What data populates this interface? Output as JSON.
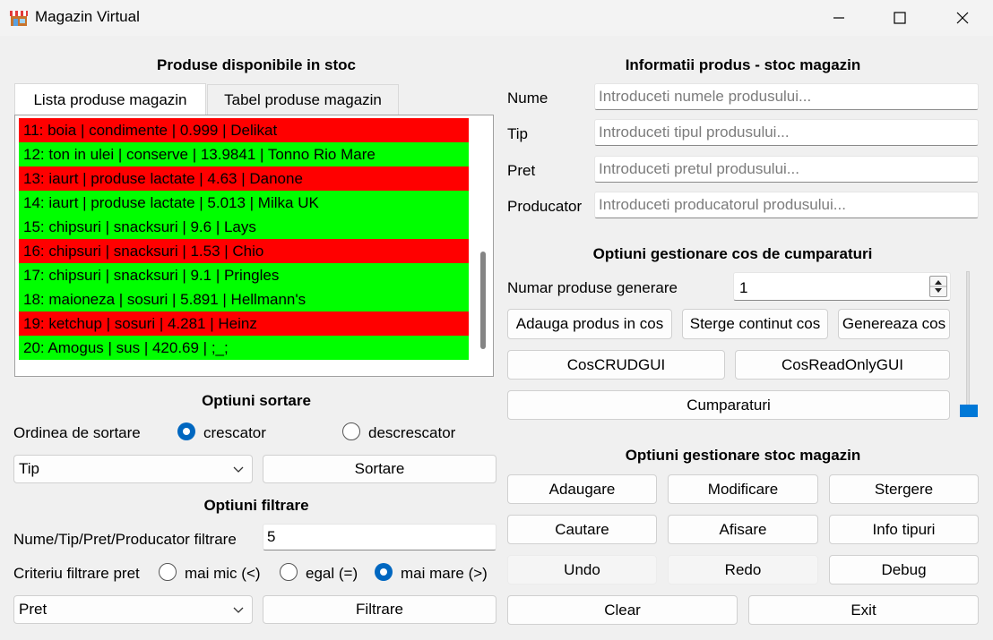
{
  "window": {
    "title": "Magazin Virtual",
    "minimize_glyph": "—",
    "maximize_glyph": "☐",
    "close_glyph": "✕"
  },
  "left": {
    "list_heading": "Produse disponibile in stoc",
    "tabs": [
      {
        "label": "Lista produse magazin",
        "active": true
      },
      {
        "label": "Tabel produse magazin",
        "active": false
      }
    ],
    "products": [
      {
        "text": "11: boia | condimente | 0.999 | Delikat",
        "color": "#ff0000"
      },
      {
        "text": "12: ton in ulei | conserve | 13.9841 | Tonno Rio Mare",
        "color": "#00ff00"
      },
      {
        "text": "13: iaurt | produse lactate | 4.63 | Danone",
        "color": "#ff0000"
      },
      {
        "text": "14: iaurt | produse lactate | 5.013 | Milka UK",
        "color": "#00ff00"
      },
      {
        "text": "15: chipsuri | snacksuri | 9.6 | Lays",
        "color": "#00ff00"
      },
      {
        "text": "16: chipsuri | snacksuri | 1.53 | Chio",
        "color": "#ff0000"
      },
      {
        "text": "17: chipsuri | snacksuri | 9.1 | Pringles",
        "color": "#00ff00"
      },
      {
        "text": "18: maioneza | sosuri | 5.891 | Hellmann's",
        "color": "#00ff00"
      },
      {
        "text": "19: ketchup | sosuri | 4.281 | Heinz",
        "color": "#ff0000"
      },
      {
        "text": "20: Amogus | sus | 420.69 | ;_;",
        "color": "#00ff00"
      }
    ],
    "sort": {
      "heading": "Optiuni sortare",
      "order_label": "Ordinea de sortare",
      "asc_label": "crescator",
      "asc_selected": true,
      "desc_label": "descrescator",
      "desc_selected": false,
      "field_value": "Tip",
      "button_label": "Sortare"
    },
    "filter": {
      "heading": "Optiuni filtrare",
      "input_label": "Nume/Tip/Pret/Producator filtrare",
      "input_value": "5",
      "criteria_label": "Criteriu filtrare pret",
      "opt_less": "mai mic (<)",
      "opt_equal": "egal (=)",
      "opt_greater": "mai mare (>)",
      "selected": "greater",
      "field_value": "Pret",
      "button_label": "Filtrare"
    }
  },
  "right": {
    "info_heading": "Informatii produs - stoc magazin",
    "fields": {
      "name_label": "Nume",
      "name_placeholder": "Introduceti numele produsului...",
      "type_label": "Tip",
      "type_placeholder": "Introduceti tipul produsului...",
      "price_label": "Pret",
      "price_placeholder": "Introduceti pretul produsului...",
      "producer_label": "Producator",
      "producer_placeholder": "Introduceti producatorul produsului..."
    },
    "cart": {
      "heading": "Optiuni gestionare cos de cumparaturi",
      "count_label": "Numar produse generare",
      "count_value": "1",
      "add_label": "Adauga produs in cos",
      "clear_label": "Sterge continut cos",
      "generate_label": "Genereaza cos",
      "crud_label": "CosCRUDGUI",
      "readonly_label": "CosReadOnlyGUI",
      "purchases_label": "Cumparaturi",
      "slider_level": 0
    },
    "stock": {
      "heading": "Optiuni gestionare stoc magazin",
      "add": "Adaugare",
      "modify": "Modificare",
      "delete": "Stergere",
      "search": "Cautare",
      "show": "Afisare",
      "types_info": "Info tipuri",
      "undo": "Undo",
      "redo": "Redo",
      "debug": "Debug",
      "clear": "Clear",
      "exit": "Exit"
    }
  }
}
